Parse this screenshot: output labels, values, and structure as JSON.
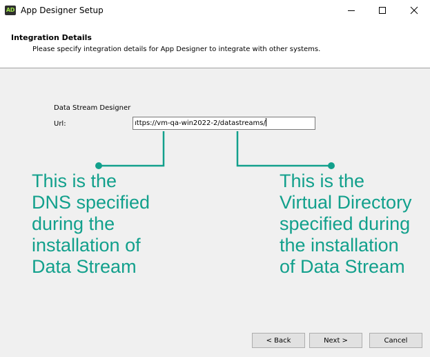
{
  "window": {
    "title": "App Designer Setup",
    "icon_label": "AD",
    "icon_name": "app-designer-icon"
  },
  "controls": {
    "minimize_icon": "minimize-icon",
    "maximize_icon": "maximize-icon",
    "close_icon": "close-icon"
  },
  "header": {
    "title": "Integration Details",
    "subtitle": "Please specify integration details for App Designer to integrate with other systems."
  },
  "form": {
    "group_label": "Data Stream Designer",
    "url_label": "Url:",
    "url_value": "ıttps://vm-qa-win2022-2/datastreams/"
  },
  "annotations": {
    "left": "This is the\nDNS specified\nduring the\ninstallation of\nData Stream",
    "right": "This is the\nVirtual Directory\nspecified during\nthe installation\nof Data Stream",
    "color": "#12a08c"
  },
  "buttons": {
    "back": "< Back",
    "next": "Next >",
    "cancel": "Cancel"
  }
}
